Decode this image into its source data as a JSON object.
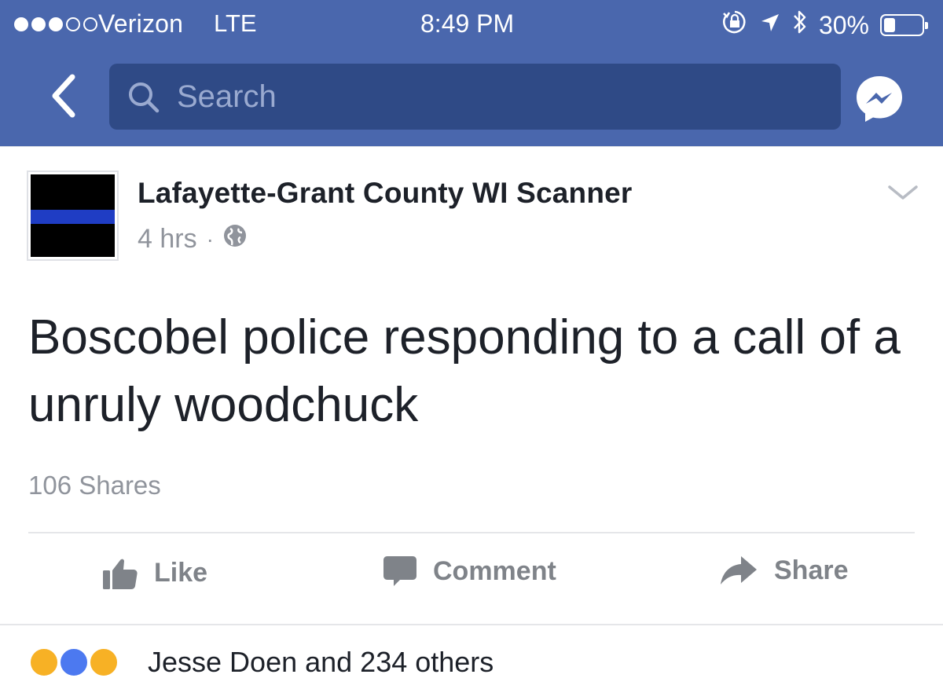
{
  "status_bar": {
    "carrier": "Verizon",
    "network": "LTE",
    "time": "8:49 PM",
    "battery_percent": "30%",
    "signal_bars_filled": 3,
    "signal_bars_total": 5,
    "battery_level": 0.3
  },
  "nav": {
    "search_placeholder": "Search"
  },
  "post": {
    "page_name": "Lafayette-Grant County WI Scanner",
    "time_ago": "4 hrs",
    "separator": "·",
    "text": "Boscobel police responding to a call of a unruly woodchuck",
    "shares": "106 Shares"
  },
  "actions": {
    "like": "Like",
    "comment": "Comment",
    "share": "Share"
  },
  "reactions": {
    "summary": "Jesse Doen and 234 others"
  },
  "colors": {
    "brand_blue": "#4a67ad",
    "search_bg": "#2f4a86",
    "muted_text": "#90949c",
    "primary_text": "#1d2129"
  }
}
